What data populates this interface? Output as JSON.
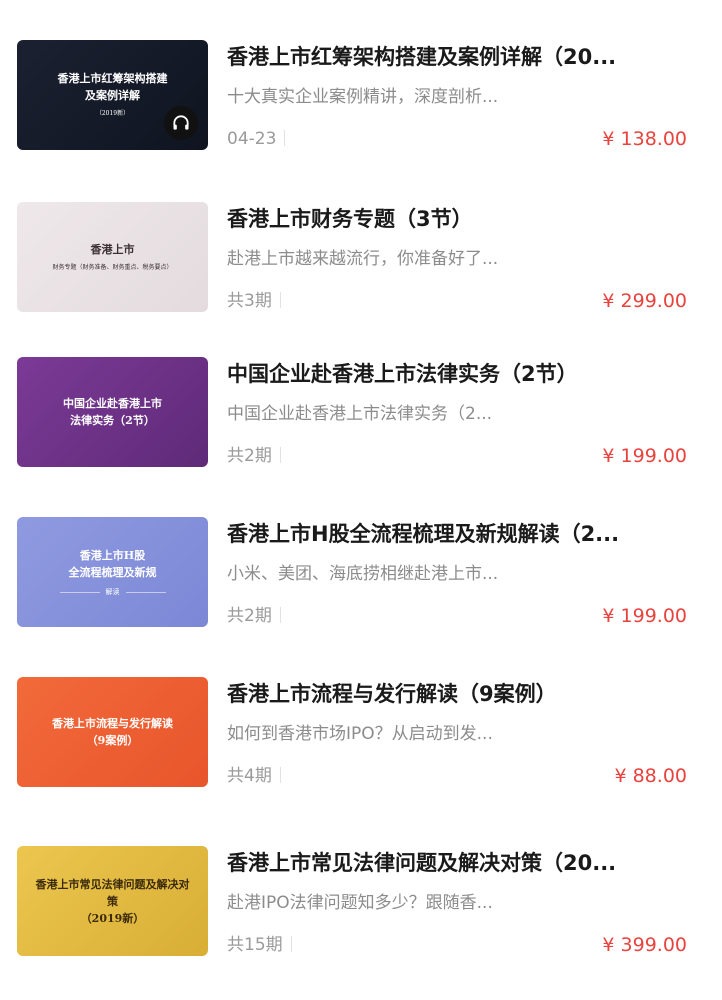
{
  "courses": [
    {
      "thumbnail": {
        "title": "香港上市红筹架构搭建\n及案例详解",
        "subtitle": "（2019新）",
        "tag": "",
        "audio_icon": "headphones-icon",
        "bg_from": "#1b2131",
        "bg_to": "#0f1420",
        "text_color": "#ffffff"
      },
      "title": "香港上市红筹架构搭建及案例详解（20...",
      "description": "十大真实企业案例精讲，深度剖析...",
      "meta": "04-23",
      "price": "¥ 138.00"
    },
    {
      "thumbnail": {
        "title": "香港上市",
        "subtitle": "财务专题（财务准备、财务重点、税务要点）",
        "tag": "",
        "audio_icon": "",
        "bg_from": "#efe8ea",
        "bg_to": "#e3dbdd",
        "text_color": "#3a3034"
      },
      "title": "香港上市财务专题（3节）",
      "description": "赴港上市越来越流行，你准备好了...",
      "meta": "共3期",
      "price": "¥ 299.00"
    },
    {
      "thumbnail": {
        "title": "中国企业赴香港上市\n法律实务（2节）",
        "subtitle": "",
        "tag": "",
        "audio_icon": "",
        "bg_from": "#7b3a96",
        "bg_to": "#5f2a78",
        "text_color": "#ffffff"
      },
      "title": "中国企业赴香港上市法律实务（2节）",
      "description": "中国企业赴香港上市法律实务（2...",
      "meta": "共2期",
      "price": "¥ 199.00"
    },
    {
      "thumbnail": {
        "title": "香港上市H股\n全流程梳理及新规",
        "subtitle": "",
        "tag": "解读",
        "audio_icon": "",
        "bg_from": "#8f9ae0",
        "bg_to": "#7c88d6",
        "text_color": "#ffffff"
      },
      "title": "香港上市H股全流程梳理及新规解读（2...",
      "description": "小米、美团、海底捞相继赴港上市...",
      "meta": "共2期",
      "price": "¥ 199.00"
    },
    {
      "thumbnail": {
        "title": "香港上市流程与发行解读\n（9案例）",
        "subtitle": "",
        "tag": "",
        "audio_icon": "",
        "bg_from": "#f26a3a",
        "bg_to": "#e8552c",
        "text_color": "#ffffff"
      },
      "title": "香港上市流程与发行解读（9案例）",
      "description": "如何到香港市场IPO？从启动到发...",
      "meta": "共4期",
      "price": "¥ 88.00"
    },
    {
      "thumbnail": {
        "title": "香港上市常见法律问题及解决对策\n（2019新）",
        "subtitle": "",
        "tag": "",
        "audio_icon": "",
        "bg_from": "#ecc64f",
        "bg_to": "#d8ae35",
        "text_color": "#3b2a0a"
      },
      "title": "香港上市常见法律问题及解决对策（20...",
      "description": "赴港IPO法律问题知多少？跟随香...",
      "meta": "共15期",
      "price": "¥ 399.00"
    }
  ]
}
